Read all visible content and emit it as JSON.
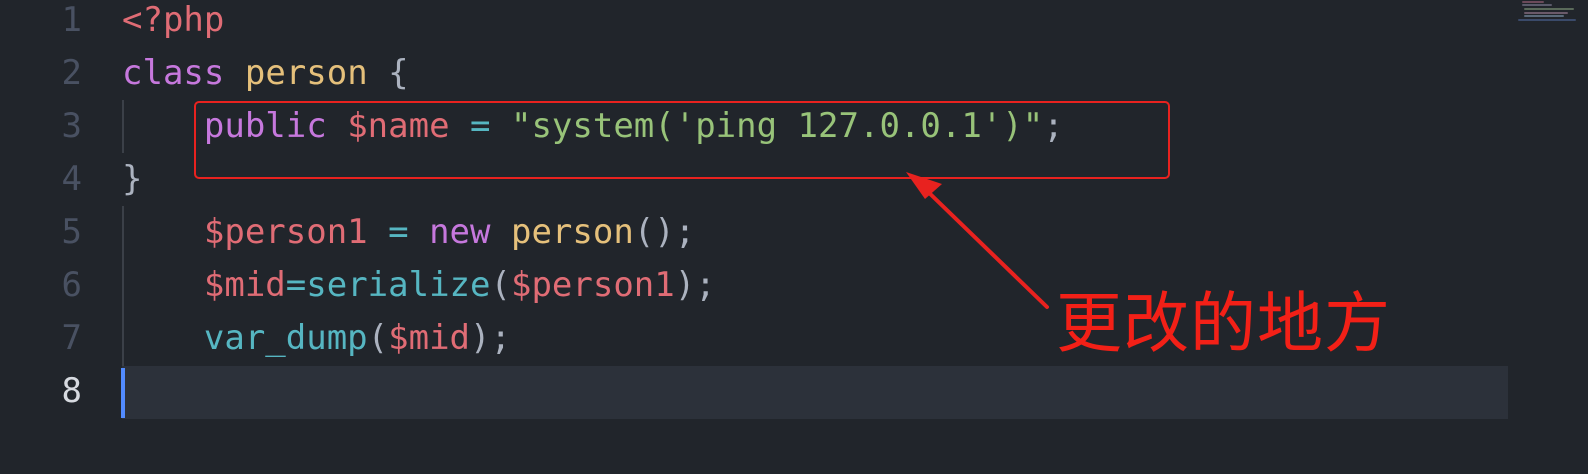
{
  "editor": {
    "language": "php",
    "active_line": 8,
    "line_numbers": [
      "1",
      "2",
      "3",
      "4",
      "5",
      "6",
      "7",
      "8"
    ],
    "lines": [
      {
        "tokens": [
          {
            "t": "<?php",
            "type": "tag"
          }
        ]
      },
      {
        "tokens": [
          {
            "t": "class",
            "type": "kw"
          },
          {
            "t": " ",
            "type": "punc"
          },
          {
            "t": "person",
            "type": "class"
          },
          {
            "t": " {",
            "type": "punc"
          }
        ]
      },
      {
        "tokens": [
          {
            "t": "    ",
            "type": "punc"
          },
          {
            "t": "public",
            "type": "kw"
          },
          {
            "t": " ",
            "type": "punc"
          },
          {
            "t": "$name",
            "type": "var"
          },
          {
            "t": " = ",
            "type": "op"
          },
          {
            "t": "\"system('ping 127.0.0.1')\"",
            "type": "str"
          },
          {
            "t": ";",
            "type": "punc"
          }
        ]
      },
      {
        "tokens": [
          {
            "t": "}",
            "type": "punc"
          }
        ]
      },
      {
        "tokens": [
          {
            "t": "    ",
            "type": "punc"
          },
          {
            "t": "$person1",
            "type": "var"
          },
          {
            "t": " = ",
            "type": "op"
          },
          {
            "t": "new",
            "type": "kw"
          },
          {
            "t": " ",
            "type": "punc"
          },
          {
            "t": "person",
            "type": "class"
          },
          {
            "t": "();",
            "type": "punc"
          }
        ]
      },
      {
        "tokens": [
          {
            "t": "    ",
            "type": "punc"
          },
          {
            "t": "$mid",
            "type": "var"
          },
          {
            "t": "=",
            "type": "op"
          },
          {
            "t": "serialize",
            "type": "fn"
          },
          {
            "t": "(",
            "type": "punc"
          },
          {
            "t": "$person1",
            "type": "var"
          },
          {
            "t": ");",
            "type": "punc"
          }
        ]
      },
      {
        "tokens": [
          {
            "t": "    ",
            "type": "punc"
          },
          {
            "t": "var_dump",
            "type": "fn"
          },
          {
            "t": "(",
            "type": "punc"
          },
          {
            "t": "$mid",
            "type": "var"
          },
          {
            "t": ");",
            "type": "punc"
          }
        ]
      },
      {
        "tokens": []
      }
    ]
  },
  "annotation": {
    "label": "更改的地方",
    "color": "#f32017",
    "target_line": 3
  },
  "colors": {
    "background": "#21252b",
    "current_line": "#2c313a",
    "cursor": "#528bff",
    "line_number": "#495162",
    "line_number_active": "#d7dae0",
    "tag": "#e06c75",
    "keyword": "#c678dd",
    "class_name": "#e5c07b",
    "variable": "#e06c75",
    "operator": "#56b6c2",
    "string": "#98c379",
    "function": "#56b6c2",
    "punctuation": "#abb2bf"
  }
}
